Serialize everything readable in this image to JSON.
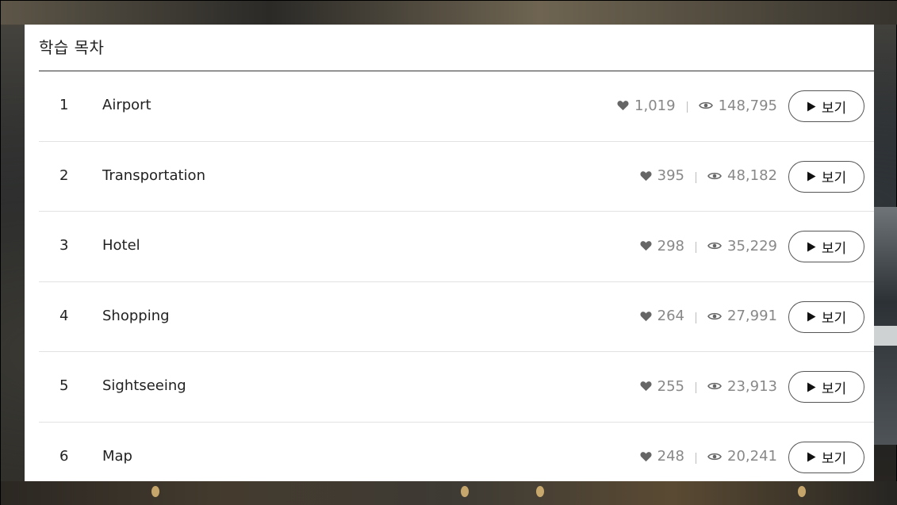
{
  "panel": {
    "title": "학습 목차"
  },
  "lessons": [
    {
      "num": "1",
      "name": "Airport",
      "likes": "1,019",
      "views": "148,795",
      "button": "보기"
    },
    {
      "num": "2",
      "name": "Transportation",
      "likes": "395",
      "views": "48,182",
      "button": "보기"
    },
    {
      "num": "3",
      "name": "Hotel",
      "likes": "298",
      "views": "35,229",
      "button": "보기"
    },
    {
      "num": "4",
      "name": "Shopping",
      "likes": "264",
      "views": "27,991",
      "button": "보기"
    },
    {
      "num": "5",
      "name": "Sightseeing",
      "likes": "255",
      "views": "23,913",
      "button": "보기"
    },
    {
      "num": "6",
      "name": "Map",
      "likes": "248",
      "views": "20,241",
      "button": "보기"
    }
  ],
  "icons": {
    "like": "heart-icon",
    "views": "eye-icon",
    "play": "play-icon"
  },
  "colors": {
    "panel_bg": "#ffffff",
    "text": "#222222",
    "muted": "#888888",
    "button_border": "#555555",
    "divider": "#e2e2e2"
  }
}
